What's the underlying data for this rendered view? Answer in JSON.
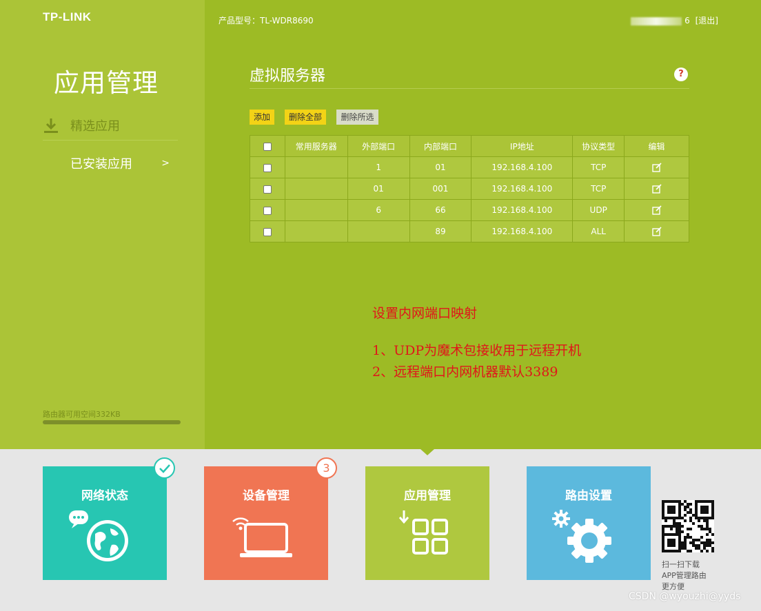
{
  "brand": {
    "logo": "TP-LINK"
  },
  "header": {
    "model": "产品型号：TL-WDR8690",
    "user_suffix": "6",
    "logout": "[退出]"
  },
  "sidebar": {
    "title": "应用管理",
    "items": [
      {
        "label": "精选应用",
        "icon": "download-icon"
      },
      {
        "label": "已安装应用",
        "icon": "grid-icon",
        "arrow": ">"
      }
    ],
    "storage_label": "路由器可用空间332KB"
  },
  "main": {
    "title": "虚拟服务器",
    "help": "?",
    "buttons": {
      "add": "添加",
      "delete_all": "删除全部",
      "delete_selected": "删除所选"
    },
    "table": {
      "headers": [
        "常用服务器",
        "外部端口",
        "内部端口",
        "IP地址",
        "协议类型",
        "编辑"
      ],
      "rows": [
        {
          "service": "",
          "ext_port": "1",
          "int_port": "01",
          "ip": "192.168.4.100",
          "protocol": "TCP"
        },
        {
          "service": "",
          "ext_port": "01",
          "int_port": "001",
          "ip": "192.168.4.100",
          "protocol": "TCP"
        },
        {
          "service": "",
          "ext_port": "6",
          "int_port": "66",
          "ip": "192.168.4.100",
          "protocol": "UDP"
        },
        {
          "service": "",
          "ext_port": "",
          "int_port": "89",
          "ip": "192.168.4.100",
          "protocol": "ALL"
        }
      ]
    }
  },
  "annotation": {
    "line1": "设置内网端口映射",
    "line2": "1、UDP为魔术包接收用于远程开机",
    "line3": "2、远程端口内网机器默认3389"
  },
  "tiles": [
    {
      "label": "网络状态",
      "icon": "globe-chat-icon"
    },
    {
      "label": "设备管理",
      "icon": "laptop-wifi-icon",
      "badge": "3"
    },
    {
      "label": "应用管理",
      "icon": "apps-grid-icon"
    },
    {
      "label": "路由设置",
      "icon": "gear-icon"
    }
  ],
  "qr": {
    "line1": "扫一扫下载",
    "line2": "APP管理路由",
    "line3": "更方便"
  },
  "watermark": "CSDN @wyouzhi@yyds",
  "colors": {
    "top_bg": "#9dbb25",
    "sidebar_bg": "#abc437",
    "tile_network": "#27c6b2",
    "tile_device": "#f07553",
    "tile_apps": "#afc83f",
    "tile_settings": "#5cb9dd",
    "annotation": "#e0151a"
  },
  "storage_used_fraction": 1.0
}
